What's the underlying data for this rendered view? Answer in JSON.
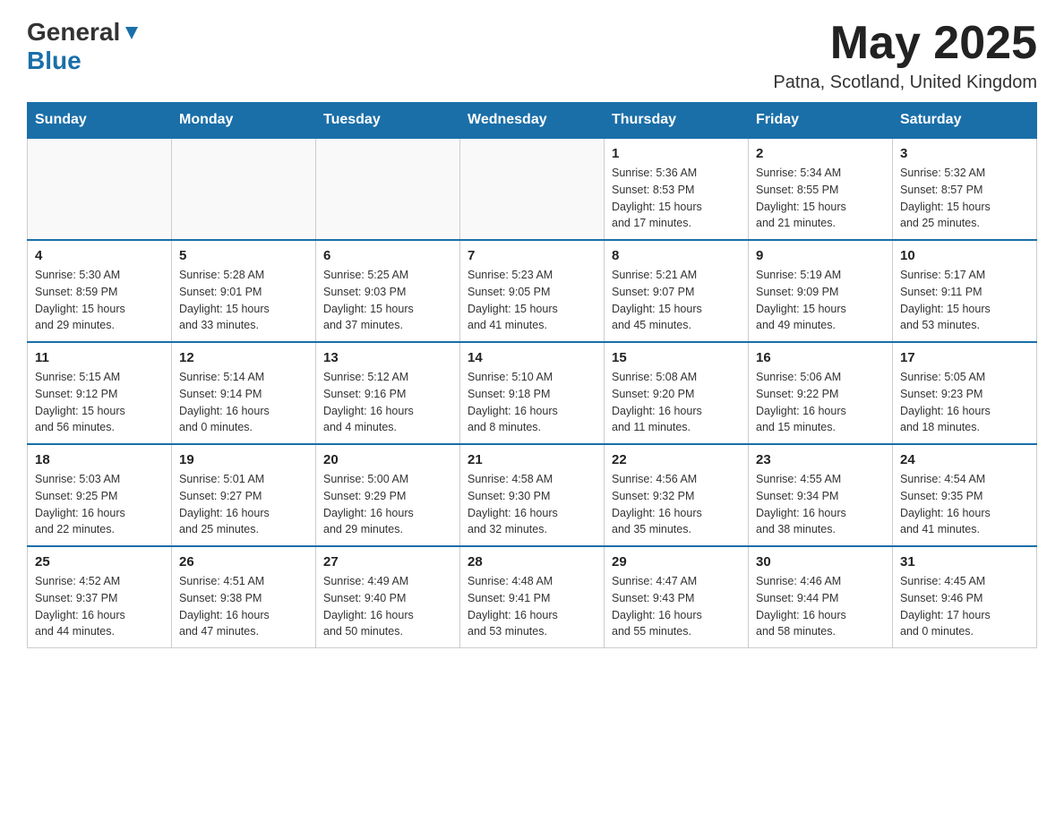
{
  "header": {
    "logo_general": "General",
    "logo_blue": "Blue",
    "month_title": "May 2025",
    "location": "Patna, Scotland, United Kingdom"
  },
  "weekdays": [
    "Sunday",
    "Monday",
    "Tuesday",
    "Wednesday",
    "Thursday",
    "Friday",
    "Saturday"
  ],
  "weeks": [
    [
      {
        "day": "",
        "info": ""
      },
      {
        "day": "",
        "info": ""
      },
      {
        "day": "",
        "info": ""
      },
      {
        "day": "",
        "info": ""
      },
      {
        "day": "1",
        "info": "Sunrise: 5:36 AM\nSunset: 8:53 PM\nDaylight: 15 hours\nand 17 minutes."
      },
      {
        "day": "2",
        "info": "Sunrise: 5:34 AM\nSunset: 8:55 PM\nDaylight: 15 hours\nand 21 minutes."
      },
      {
        "day": "3",
        "info": "Sunrise: 5:32 AM\nSunset: 8:57 PM\nDaylight: 15 hours\nand 25 minutes."
      }
    ],
    [
      {
        "day": "4",
        "info": "Sunrise: 5:30 AM\nSunset: 8:59 PM\nDaylight: 15 hours\nand 29 minutes."
      },
      {
        "day": "5",
        "info": "Sunrise: 5:28 AM\nSunset: 9:01 PM\nDaylight: 15 hours\nand 33 minutes."
      },
      {
        "day": "6",
        "info": "Sunrise: 5:25 AM\nSunset: 9:03 PM\nDaylight: 15 hours\nand 37 minutes."
      },
      {
        "day": "7",
        "info": "Sunrise: 5:23 AM\nSunset: 9:05 PM\nDaylight: 15 hours\nand 41 minutes."
      },
      {
        "day": "8",
        "info": "Sunrise: 5:21 AM\nSunset: 9:07 PM\nDaylight: 15 hours\nand 45 minutes."
      },
      {
        "day": "9",
        "info": "Sunrise: 5:19 AM\nSunset: 9:09 PM\nDaylight: 15 hours\nand 49 minutes."
      },
      {
        "day": "10",
        "info": "Sunrise: 5:17 AM\nSunset: 9:11 PM\nDaylight: 15 hours\nand 53 minutes."
      }
    ],
    [
      {
        "day": "11",
        "info": "Sunrise: 5:15 AM\nSunset: 9:12 PM\nDaylight: 15 hours\nand 56 minutes."
      },
      {
        "day": "12",
        "info": "Sunrise: 5:14 AM\nSunset: 9:14 PM\nDaylight: 16 hours\nand 0 minutes."
      },
      {
        "day": "13",
        "info": "Sunrise: 5:12 AM\nSunset: 9:16 PM\nDaylight: 16 hours\nand 4 minutes."
      },
      {
        "day": "14",
        "info": "Sunrise: 5:10 AM\nSunset: 9:18 PM\nDaylight: 16 hours\nand 8 minutes."
      },
      {
        "day": "15",
        "info": "Sunrise: 5:08 AM\nSunset: 9:20 PM\nDaylight: 16 hours\nand 11 minutes."
      },
      {
        "day": "16",
        "info": "Sunrise: 5:06 AM\nSunset: 9:22 PM\nDaylight: 16 hours\nand 15 minutes."
      },
      {
        "day": "17",
        "info": "Sunrise: 5:05 AM\nSunset: 9:23 PM\nDaylight: 16 hours\nand 18 minutes."
      }
    ],
    [
      {
        "day": "18",
        "info": "Sunrise: 5:03 AM\nSunset: 9:25 PM\nDaylight: 16 hours\nand 22 minutes."
      },
      {
        "day": "19",
        "info": "Sunrise: 5:01 AM\nSunset: 9:27 PM\nDaylight: 16 hours\nand 25 minutes."
      },
      {
        "day": "20",
        "info": "Sunrise: 5:00 AM\nSunset: 9:29 PM\nDaylight: 16 hours\nand 29 minutes."
      },
      {
        "day": "21",
        "info": "Sunrise: 4:58 AM\nSunset: 9:30 PM\nDaylight: 16 hours\nand 32 minutes."
      },
      {
        "day": "22",
        "info": "Sunrise: 4:56 AM\nSunset: 9:32 PM\nDaylight: 16 hours\nand 35 minutes."
      },
      {
        "day": "23",
        "info": "Sunrise: 4:55 AM\nSunset: 9:34 PM\nDaylight: 16 hours\nand 38 minutes."
      },
      {
        "day": "24",
        "info": "Sunrise: 4:54 AM\nSunset: 9:35 PM\nDaylight: 16 hours\nand 41 minutes."
      }
    ],
    [
      {
        "day": "25",
        "info": "Sunrise: 4:52 AM\nSunset: 9:37 PM\nDaylight: 16 hours\nand 44 minutes."
      },
      {
        "day": "26",
        "info": "Sunrise: 4:51 AM\nSunset: 9:38 PM\nDaylight: 16 hours\nand 47 minutes."
      },
      {
        "day": "27",
        "info": "Sunrise: 4:49 AM\nSunset: 9:40 PM\nDaylight: 16 hours\nand 50 minutes."
      },
      {
        "day": "28",
        "info": "Sunrise: 4:48 AM\nSunset: 9:41 PM\nDaylight: 16 hours\nand 53 minutes."
      },
      {
        "day": "29",
        "info": "Sunrise: 4:47 AM\nSunset: 9:43 PM\nDaylight: 16 hours\nand 55 minutes."
      },
      {
        "day": "30",
        "info": "Sunrise: 4:46 AM\nSunset: 9:44 PM\nDaylight: 16 hours\nand 58 minutes."
      },
      {
        "day": "31",
        "info": "Sunrise: 4:45 AM\nSunset: 9:46 PM\nDaylight: 17 hours\nand 0 minutes."
      }
    ]
  ]
}
